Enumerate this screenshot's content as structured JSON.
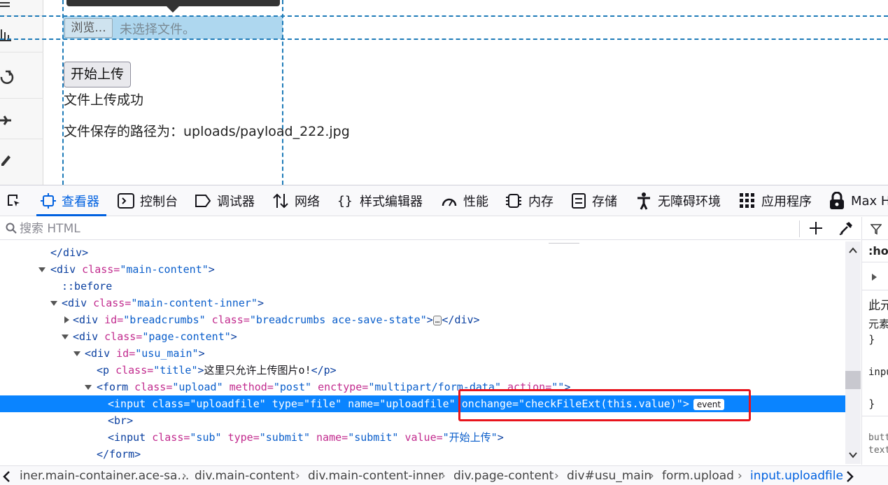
{
  "page": {
    "browse_label": "浏览...",
    "file_status": "未选择文件。",
    "submit_label": "开始上传",
    "message_success": "文件上传成功",
    "message_path": "文件保存的路径为：uploads/payload_222.jpg"
  },
  "devtools": {
    "tabs": [
      {
        "label": "查看器",
        "icon": "inspector-icon",
        "active": true
      },
      {
        "label": "控制台",
        "icon": "console-icon"
      },
      {
        "label": "调试器",
        "icon": "debugger-icon"
      },
      {
        "label": "网络",
        "icon": "network-icon"
      },
      {
        "label": "样式编辑器",
        "icon": "style-editor-icon"
      },
      {
        "label": "性能",
        "icon": "performance-icon"
      },
      {
        "label": "内存",
        "icon": "memory-icon"
      },
      {
        "label": "存储",
        "icon": "storage-icon"
      },
      {
        "label": "无障碍环境",
        "icon": "accessibility-icon"
      },
      {
        "label": "应用程序",
        "icon": "application-icon"
      },
      {
        "label": "Max H",
        "icon": "lock-icon"
      }
    ],
    "search_placeholder": "搜索 HTML",
    "markup": {
      "rows": [
        {
          "parts": [
            "</div>"
          ]
        },
        {
          "parts": [
            "<div",
            " class=",
            "\"main-content\"",
            ">"
          ]
        },
        {
          "parts": [
            "::before"
          ]
        },
        {
          "parts": [
            "<div",
            " class=",
            "\"main-content-inner\"",
            ">"
          ]
        },
        {
          "parts": [
            "<div",
            " id=",
            "\"breadcrumbs\"",
            " class=",
            "\"breadcrumbs ace-save-state\"",
            ">",
            "…",
            "</div>"
          ]
        },
        {
          "parts": [
            "<div",
            " class=",
            "\"page-content\"",
            ">"
          ]
        },
        {
          "parts": [
            "<div",
            " id=",
            "\"usu_main\"",
            ">"
          ]
        },
        {
          "parts": [
            "<p",
            " class=",
            "\"title\"",
            ">",
            "这里只允许上传图片o!",
            "</p>"
          ]
        },
        {
          "parts": [
            "<form",
            " class=",
            "\"upload\"",
            " method=",
            "\"post\"",
            " enctype=",
            "\"multipart/form-data\"",
            " action=",
            "\"\"",
            ">"
          ]
        },
        {
          "parts": [
            "<input",
            " class=",
            "\"uploadfile\"",
            " type=",
            "\"file\"",
            " name=",
            "\"uploadfile\"",
            " onchange=",
            "\"checkFileExt(this.value)\"",
            ">"
          ],
          "badge": "event"
        },
        {
          "parts": [
            "<br>"
          ]
        },
        {
          "parts": [
            "<input",
            " class=",
            "\"sub\"",
            " type=",
            "\"submit\"",
            " name=",
            "\"submit\"",
            " value=",
            "\"开始上传\"",
            ">"
          ]
        },
        {
          "parts": [
            "</form>"
          ]
        }
      ]
    },
    "side_panel": [
      ":hov",
      "此元",
      "元素",
      "}",
      "inpu",
      "}",
      "butt",
      "text"
    ],
    "breadcrumbs": [
      "iner.main-container.ace-sa…",
      "div.main-content",
      "div.main-content-inner",
      "div.page-content",
      "div#usu_main",
      "form.upload",
      "input.uploadfile"
    ],
    "colors": {
      "accent": "#0061e0",
      "selection": "#0a84ff",
      "annotation": "#e8141c"
    }
  }
}
